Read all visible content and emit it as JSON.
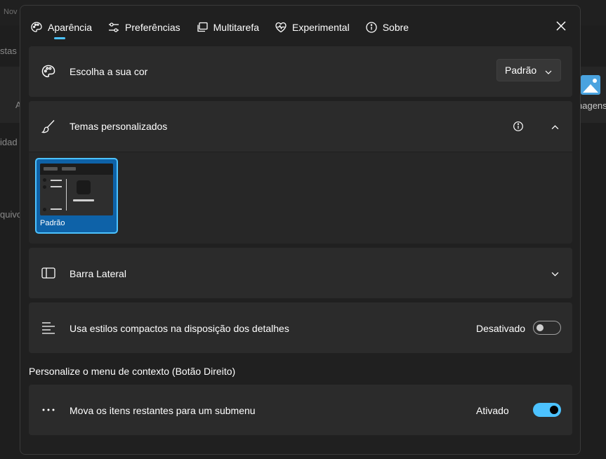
{
  "background": {
    "frag_top": "Nov",
    "frag_stas": "stas",
    "frag_a": "A",
    "frag_idad": "idad",
    "frag_quivo": "quivo",
    "frag_imagens": "nagens"
  },
  "tabs": [
    {
      "label": "Aparência",
      "icon": "palette-icon",
      "active": true
    },
    {
      "label": "Preferências",
      "icon": "sliders-icon"
    },
    {
      "label": "Multitarefa",
      "icon": "multitask-icon"
    },
    {
      "label": "Experimental",
      "icon": "heart-pulse-icon"
    },
    {
      "label": "Sobre",
      "icon": "info-icon"
    }
  ],
  "color_row": {
    "label": "Escolha a sua cor",
    "dropdown_value": "Padrão",
    "icon": "palette-icon"
  },
  "themes_row": {
    "label": "Temas personalizados",
    "icon": "brush-icon",
    "theme_name": "Padrão"
  },
  "sidebar_row": {
    "label": "Barra Lateral",
    "icon": "sidebar-icon"
  },
  "compact_row": {
    "label": "Usa estilos compactos na disposição dos detalhes",
    "state": "Desativado",
    "icon": "list-lines-icon",
    "on": false
  },
  "context_section": {
    "title": "Personalize o menu de contexto (Botão Direito)"
  },
  "submenu_row": {
    "label": "Mova os itens restantes para um submenu",
    "state": "Ativado",
    "icon": "more-dots-icon",
    "on": true
  },
  "colors": {
    "accent": "#4cc2ff",
    "card": "#2b2b2b",
    "dialog": "#202020"
  }
}
